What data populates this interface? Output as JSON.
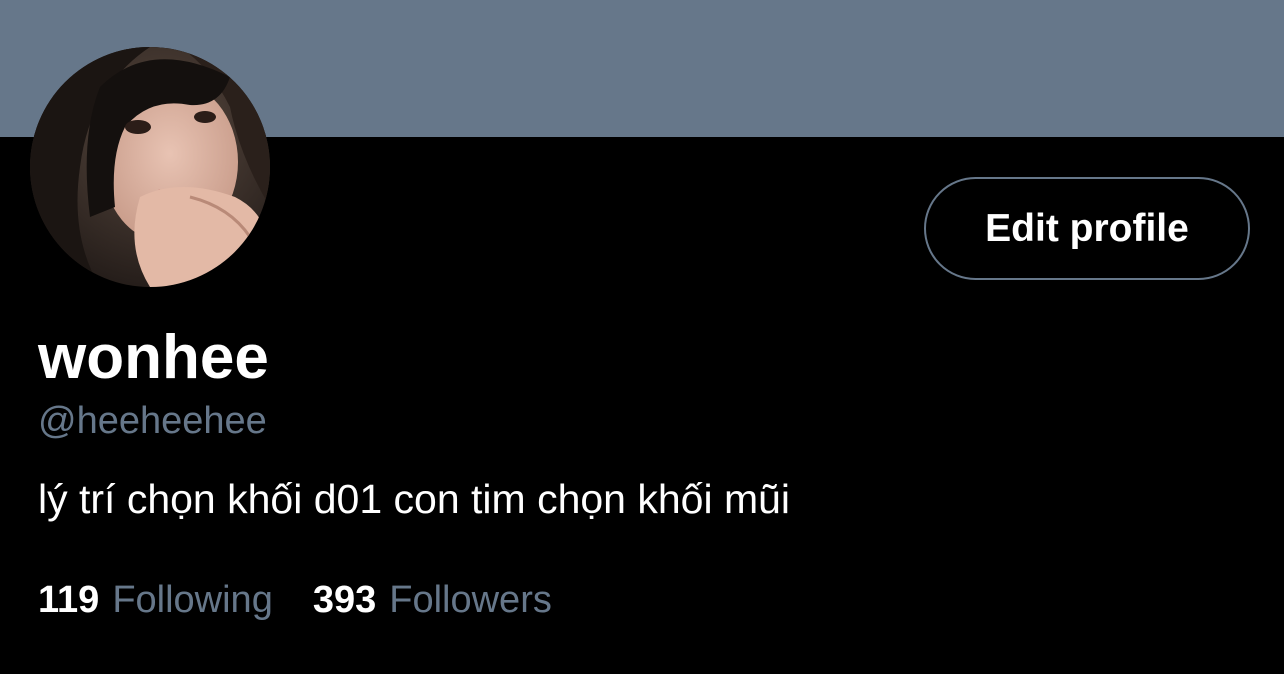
{
  "profile": {
    "display_name": "wonhee",
    "handle": "@heeheehee",
    "bio": "lý trí chọn khối d01 con tim chọn khối mũi",
    "edit_button_label": "Edit profile"
  },
  "stats": {
    "following_count": "119",
    "following_label": "Following",
    "followers_count": "393",
    "followers_label": "Followers"
  },
  "colors": {
    "banner": "#66778a",
    "background": "#000000",
    "secondary_text": "#66778a",
    "primary_text": "#ffffff"
  }
}
